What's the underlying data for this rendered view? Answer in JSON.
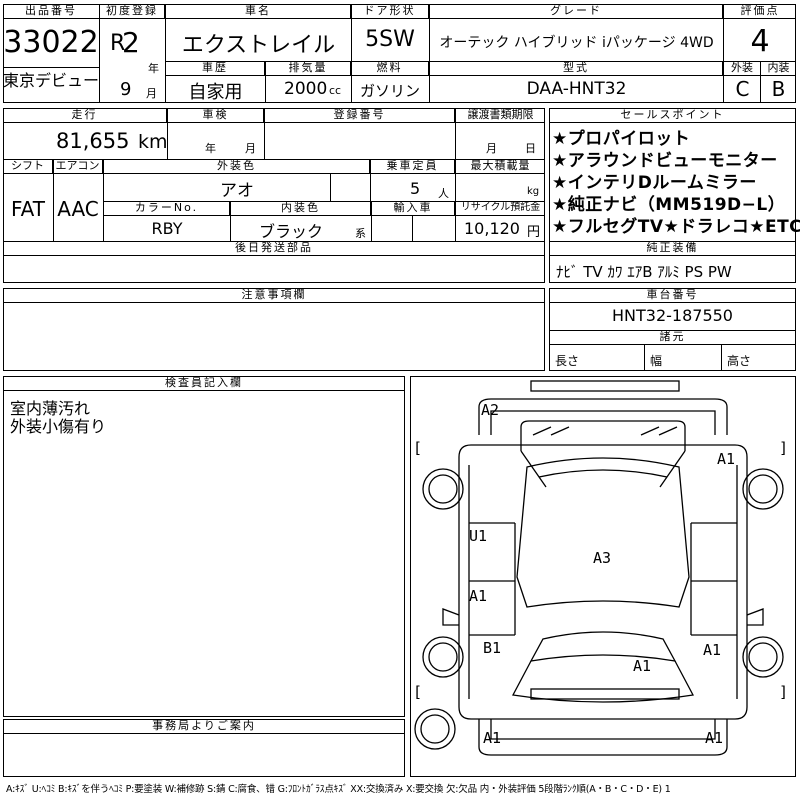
{
  "header": {
    "lot_label": "出品番号",
    "lot_number": "33022",
    "lot_note": "東京デビュー",
    "reg_label": "初度登録",
    "reg_era": "R",
    "reg_year": "2",
    "year_unit": "年",
    "reg_month": "9",
    "month_unit": "月",
    "car_name_label": "車名",
    "car_name": "エクストレイル",
    "door_label": "ドア形状",
    "door": "5SW",
    "grade_label": "グレード",
    "grade": "オーテック ハイブリッド iパッケージ 4WD",
    "score_label": "評価点",
    "score": "4",
    "history_label": "車歴",
    "history": "自家用",
    "displacement_label": "排気量",
    "displacement": "2000",
    "displacement_unit": "cc",
    "fuel_label": "燃料",
    "fuel": "ガソリン",
    "model_label": "型式",
    "model": "DAA-HNT32",
    "ext_label": "外装",
    "ext_grade": "C",
    "int_label": "内装",
    "int_grade": "B"
  },
  "specs": {
    "mileage_label": "走行",
    "mileage": "81,655",
    "mileage_unit": "km",
    "inspection_label": "車検",
    "inspection_year_unit": "年",
    "inspection_month_unit": "月",
    "plate_label": "登録番号",
    "transfer_label": "譲渡書類期限",
    "transfer_month_unit": "月",
    "transfer_day_unit": "日",
    "shift_label": "シフト",
    "shift": "FAT",
    "ac_label": "エアコン",
    "ac": "AAC",
    "color_label": "外装色",
    "color": "アオ",
    "seats_label": "乗車定員",
    "seats": "5",
    "seats_unit": "人",
    "load_label": "最大積載量",
    "load_unit": "kg",
    "color_no_label": "カラーNo.",
    "color_no": "RBY",
    "interior_color_label": "内装色",
    "interior_color": "ブラック",
    "interior_color_unit": "系",
    "import_label": "輸入車",
    "recycle_label": "リサイクル預託金",
    "recycle": "10,120",
    "recycle_unit": "円",
    "later_parts_label": "後日発送部品"
  },
  "sales_points": {
    "label": "セールスポイント",
    "items": [
      "★プロパイロット",
      "★アラウンドビューモニター",
      "★インテリDルームミラー",
      "★純正ナビ（MM519D−L）",
      "★フルセグTV★ドラレコ★ETC"
    ]
  },
  "equipment": {
    "label": "純正装備",
    "text": "ﾅﾋﾞ TV ｶﾜ ｴｱB ｱﾙﾐ PS PW"
  },
  "chassis": {
    "label": "車台番号",
    "number": "HNT32-187550"
  },
  "dims": {
    "label": "諸元",
    "length_label": "長さ",
    "width_label": "幅",
    "height_label": "高さ"
  },
  "notes": {
    "label": "注意事項欄"
  },
  "inspector": {
    "label": "検査員記入欄",
    "lines": [
      "室内薄汚れ",
      "外装小傷有り"
    ]
  },
  "office": {
    "label": "事務局よりご案内"
  },
  "diagram": {
    "marks": [
      {
        "id": "rear-bumper",
        "text": "A2"
      },
      {
        "id": "right-rear-tire",
        "text": "A1"
      },
      {
        "id": "left-rear-door",
        "text": "U1"
      },
      {
        "id": "roof",
        "text": "A3"
      },
      {
        "id": "left-front-door",
        "text": "A1"
      },
      {
        "id": "left-front-fender",
        "text": "B1"
      },
      {
        "id": "hood",
        "text": "A1"
      },
      {
        "id": "right-front-tire",
        "text": "A1"
      },
      {
        "id": "front-bumper-left",
        "text": "A1"
      },
      {
        "id": "front-bumper-right",
        "text": "A1"
      }
    ],
    "brackets": [
      "[",
      "]"
    ]
  },
  "legend": "A:ｷｽﾞ U:ﾍｺﾐ B:ｷｽﾞを伴うﾍｺﾐ P:要塗装 W:補修跡 S:錆 C:腐食、错 G:ﾌﾛﾝﾄｶﾞﾗｽ点ｷｽﾞ XX:交換済み X:要交換 欠:欠品 内・外装評価 5段階ﾗﾝｸ順(A・B・C・D・E) 1"
}
